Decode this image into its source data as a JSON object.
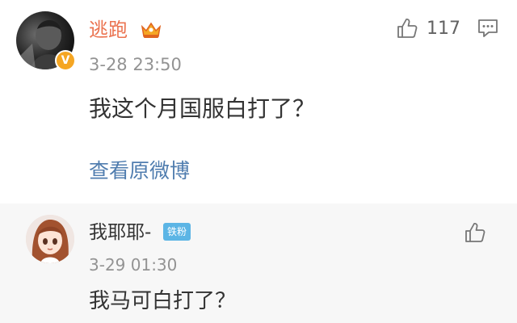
{
  "comment": {
    "username": "逃跑",
    "timestamp": "3-28 23:50",
    "likes": "117",
    "content": "我这个月国服白打了？",
    "view_original": "查看原微博",
    "icons": {
      "verified": "verified-badge-icon",
      "vip": "vip-crown-icon",
      "like": "thumbs-up-icon",
      "comment": "comment-icon"
    },
    "colors": {
      "username": "#eb7350",
      "link": "#507daf",
      "verified": "#f5a623"
    }
  },
  "reply": {
    "username": "我耶耶-",
    "fan_badge": "铁粉",
    "timestamp": "3-29 01:30",
    "content": "我马可白打了？",
    "icons": {
      "like": "thumbs-up-icon"
    },
    "colors": {
      "background": "#f7f7f7",
      "badge": "#5cb5e5"
    }
  }
}
